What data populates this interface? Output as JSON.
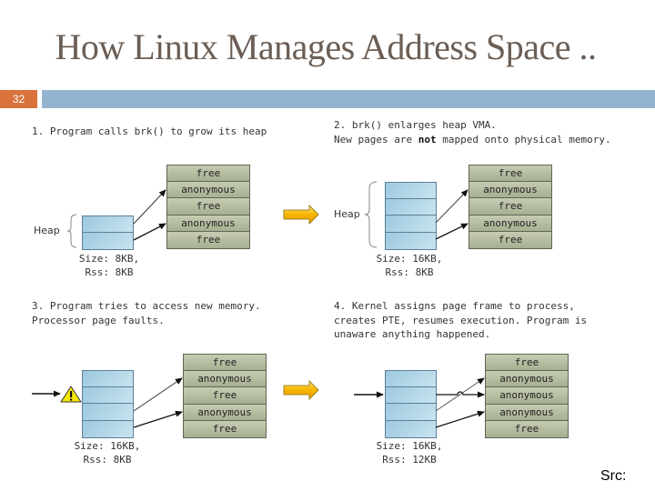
{
  "slide": {
    "title": "How Linux Manages Address Space ..",
    "number": "32",
    "source_label": "Src:"
  },
  "colors": {
    "title": "#6b5e55",
    "slide_number_bg": "#d9733b",
    "header_rule": "#93b3d0",
    "physical_page": "#b5bd9f",
    "heap_page": "#aed5e8",
    "transition_arrow": "#f5b800",
    "warning": "#f7e600"
  },
  "panels": [
    {
      "step": "1",
      "caption_lines": [
        "1. Program calls brk() to grow its heap"
      ],
      "heap_label": "Heap",
      "heap_pages": 2,
      "physical_pages": [
        "free",
        "anonymous",
        "free",
        "anonymous",
        "free"
      ],
      "size_label": "Size: 8KB,",
      "rss_label": "Rss: 8KB"
    },
    {
      "step": "2",
      "caption_line1": "2. brk() enlarges heap VMA.",
      "caption_line2_pre": "New pages are ",
      "caption_line2_bold": "not",
      "caption_line2_post": " mapped onto physical memory.",
      "heap_label": "Heap",
      "heap_pages": 4,
      "physical_pages": [
        "free",
        "anonymous",
        "free",
        "anonymous",
        "free"
      ],
      "size_label": "Size: 16KB,",
      "rss_label": "Rss: 8KB"
    },
    {
      "step": "3",
      "caption_lines": [
        "3. Program tries to access new memory.",
        "Processor page faults."
      ],
      "heap_pages": 4,
      "warning_icon": "warning-triangle",
      "physical_pages": [
        "free",
        "anonymous",
        "free",
        "anonymous",
        "free"
      ],
      "size_label": "Size: 16KB,",
      "rss_label": "Rss: 8KB"
    },
    {
      "step": "4",
      "caption_lines": [
        "4. Kernel assigns page frame to process,",
        "creates PTE, resumes execution. Program is",
        "unaware anything happened."
      ],
      "heap_pages": 4,
      "physical_pages": [
        "free",
        "anonymous",
        "anonymous",
        "anonymous",
        "free"
      ],
      "size_label": "Size: 16KB,",
      "rss_label": "Rss: 12KB"
    }
  ]
}
